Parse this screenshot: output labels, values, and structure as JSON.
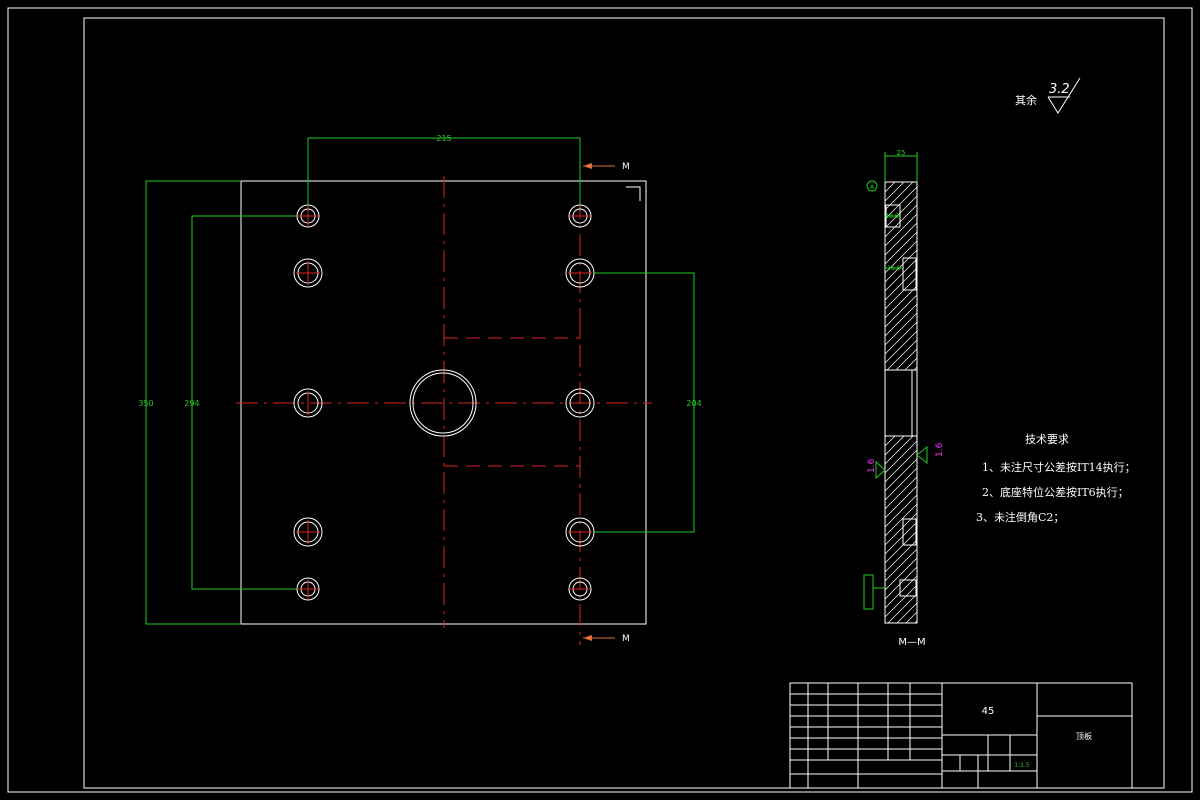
{
  "colors": {
    "background": "#000000",
    "outline": "#ffffff",
    "dimension": "#22cc22",
    "centerline": "#dd2222",
    "section_marker": "#e0703a",
    "roughness_side": "#ff33ff"
  },
  "roughness": {
    "prefix": "其余",
    "value": "3.2"
  },
  "plan_view": {
    "dim_top": "215",
    "dim_left_outer": "350",
    "dim_left_inner": "294",
    "dim_right": "204",
    "section_label_top": "M",
    "section_label_bottom": "M"
  },
  "section_view": {
    "thickness": "25",
    "counterbore_1": "10.5",
    "counterbore_2": "15.5",
    "roughness_left": "1.6",
    "roughness_right": "1.6",
    "title": "M—M"
  },
  "tech_requirements": {
    "heading": "技术要求",
    "items": [
      "1、未注尺寸公差按IT14执行；",
      "2、底座特位公差按IT6执行；",
      "3、未注倒角C2；"
    ]
  },
  "title_block": {
    "material": "45",
    "part_name": "顶板",
    "scale": "1:1.5"
  }
}
